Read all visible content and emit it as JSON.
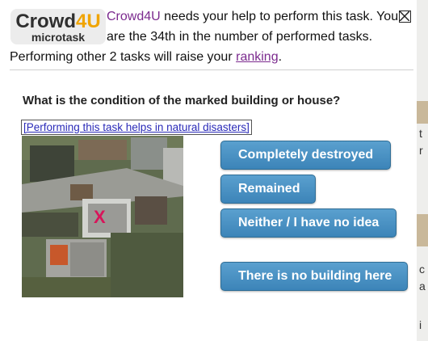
{
  "logo": {
    "part1": "Crowd",
    "part2": "4U",
    "subtitle": "microtask"
  },
  "message": {
    "link": "Crowd4U",
    "line1_rest": " needs your help to perform this task. You",
    "line2": "are the 34th in the number of performed tasks.",
    "line3_prefix": "Performing other 2 tasks will raise your ",
    "ranking_link": "ranking",
    "line3_suffix": "."
  },
  "task": {
    "question": "What is the condition of the marked building or house?",
    "disaster_link": "[Performing this task helps in natural disasters]",
    "marker": "X"
  },
  "options": [
    {
      "label": "Completely destroyed"
    },
    {
      "label": "Remained"
    },
    {
      "label": "Neither / I have no idea"
    },
    {
      "label": "There is no building here"
    }
  ],
  "edge_glyphs": [
    "t",
    "r",
    "c",
    "a",
    "i"
  ],
  "colors": {
    "button_fill": "#4a92c4",
    "link": "#7b2a8e",
    "marker": "#d8145a"
  }
}
